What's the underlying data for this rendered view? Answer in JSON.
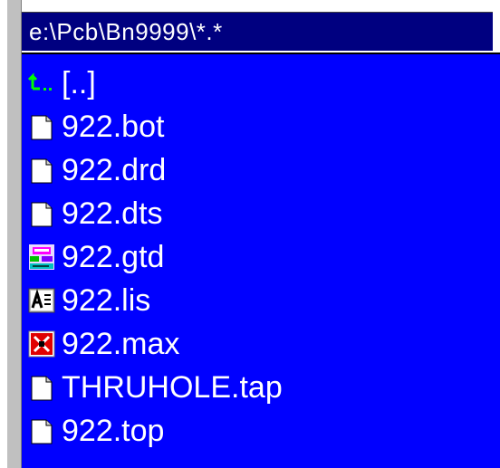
{
  "path_bar": {
    "path": "e:\\Pcb\\Bn9999\\*.*"
  },
  "files": [
    {
      "name": "[..]",
      "icon": "parent-directory-icon"
    },
    {
      "name": "922.bot",
      "icon": "document-icon"
    },
    {
      "name": "922.drd",
      "icon": "document-icon"
    },
    {
      "name": "922.dts",
      "icon": "document-icon"
    },
    {
      "name": "922.gtd",
      "icon": "gerber-app-icon"
    },
    {
      "name": "922.lis",
      "icon": "text-list-icon"
    },
    {
      "name": "922.max",
      "icon": "red-app-icon"
    },
    {
      "name": "THRUHOLE.tap",
      "icon": "document-icon"
    },
    {
      "name": "922.top",
      "icon": "document-icon"
    }
  ],
  "colors": {
    "panel_background": "#0000ff",
    "path_bar_background": "#000080",
    "text": "#ffffff"
  }
}
